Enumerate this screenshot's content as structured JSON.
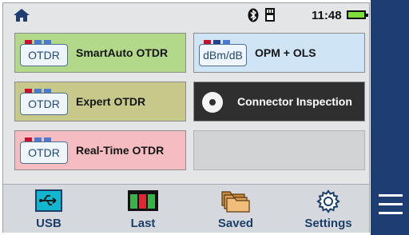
{
  "status_bar": {
    "time": "11:48",
    "icons": [
      "home-icon",
      "bluetooth-icon",
      "sd-card-icon",
      "battery-icon"
    ]
  },
  "tiles": [
    {
      "badge": "OTDR",
      "label": "SmartAuto OTDR",
      "color": "#b2d88a"
    },
    {
      "badge": "dBm/dB",
      "label": "OPM + OLS",
      "color": "#cfe4f5"
    },
    {
      "badge": "OTDR",
      "label": "Expert OTDR",
      "color": "#c7c98a"
    },
    {
      "icon": "fiber-connector-icon",
      "label": "Connector Inspection",
      "color": "#2f2f2f"
    },
    {
      "badge": "OTDR",
      "label": "Real-Time OTDR",
      "color": "#f5bcc1"
    }
  ],
  "navbar": [
    {
      "label": "USB",
      "icon": "usb-icon"
    },
    {
      "label": "Last",
      "icon": "last-results-icon"
    },
    {
      "label": "Saved",
      "icon": "folders-icon"
    },
    {
      "label": "Settings",
      "icon": "gear-icon"
    }
  ],
  "side_menu": {
    "icon": "hamburger-menu-icon"
  },
  "colors": {
    "side_bar": "#1e3d73",
    "nav_text": "#1c3f6a",
    "screen_bg": "#e4e5e7"
  }
}
